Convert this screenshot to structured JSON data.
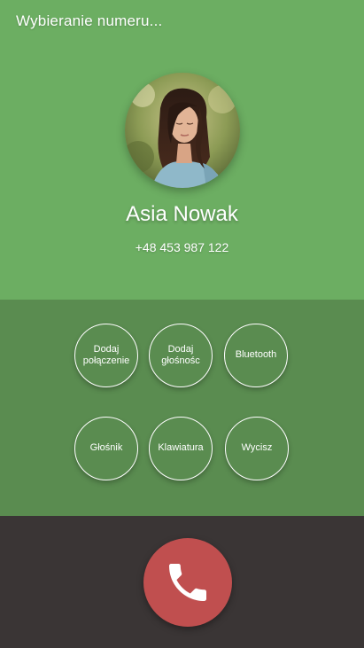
{
  "header": {
    "status": "Wybieranie numeru..."
  },
  "contact": {
    "name": "Asia Nowak",
    "phone": "+48 453 987 122"
  },
  "controls": {
    "add_call": "Dodaj\npołączenie",
    "add_volume": "Dodaj\ngłośnośc",
    "bluetooth": "Bluetooth",
    "speaker": "Głośnik",
    "keypad": "Klawiatura",
    "mute": "Wycisz"
  },
  "colors": {
    "top_green": "#6cae62",
    "controls_green": "#5a8c50",
    "bottom_dark": "#3a3535",
    "hangup_red": "#c04f4f"
  },
  "icons": {
    "hangup": "phone-icon"
  }
}
